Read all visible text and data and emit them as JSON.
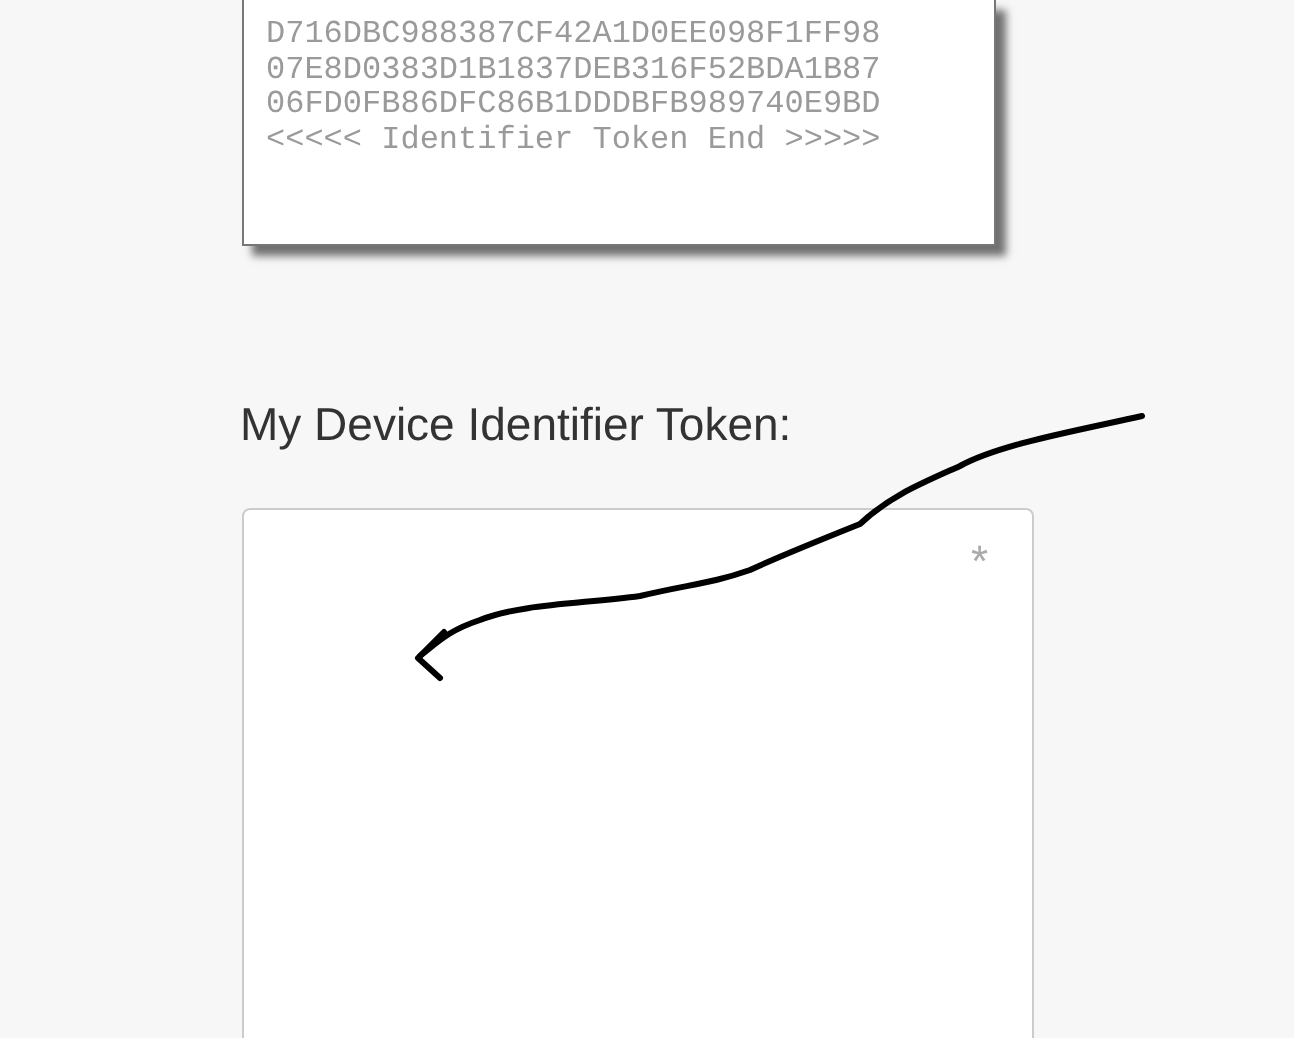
{
  "token_card": {
    "lines": [
      "D716DBC988387CF42A1D0EE098F1FF98",
      "07E8D0383D1B1837DEB316F52BDA1B87",
      "06FD0FB86DFC86B1DDDBFB989740E9BD"
    ],
    "end_marker": "<<<<< Identifier Token End >>>>>"
  },
  "device_token": {
    "label": "My Device Identifier Token:",
    "required_mark": "*"
  }
}
